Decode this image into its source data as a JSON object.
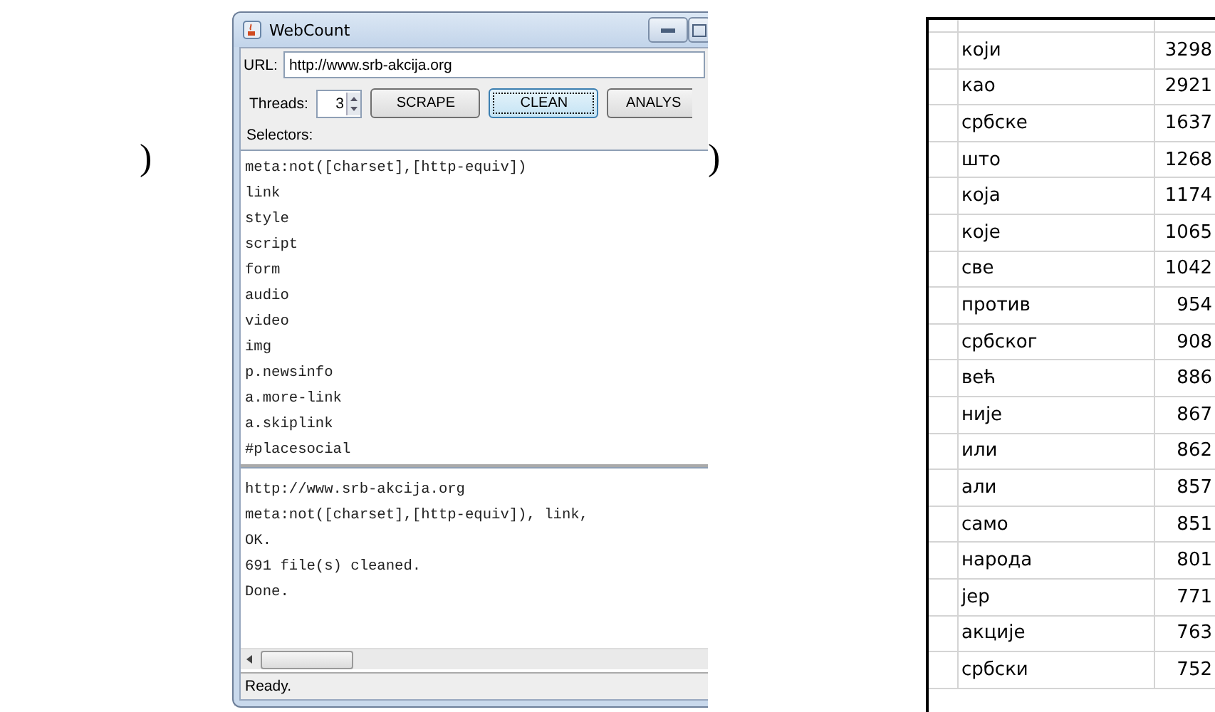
{
  "brackets": [
    ")",
    ")"
  ],
  "window": {
    "title": "WebCount",
    "url_label": "URL:",
    "url": "http://www.srb-akcija.org",
    "threads_label": "Threads:",
    "threads": "3",
    "buttons": [
      {
        "label": "SCRAPE",
        "focused": false
      },
      {
        "label": "CLEAN",
        "focused": true
      },
      {
        "label": "ANALYS",
        "focused": false
      }
    ],
    "selectors_label": "Selectors:",
    "selectors": [
      "meta:not([charset],[http-equiv])",
      "link",
      "style",
      "script",
      "form",
      "audio",
      "video",
      "img",
      "p.newsinfo",
      "a.more-link",
      "a.skiplink",
      "#placesocial"
    ],
    "log": [
      "http://www.srb-akcija.org",
      "meta:not([charset],[http-equiv]), link,",
      "OK.",
      "691 file(s) cleaned.",
      "Done."
    ],
    "status_bar": "Ready."
  },
  "table": {
    "rows": [
      {
        "word": "који",
        "count": "3298"
      },
      {
        "word": "као",
        "count": "2921"
      },
      {
        "word": "србске",
        "count": "1637"
      },
      {
        "word": "што",
        "count": "1268"
      },
      {
        "word": "која",
        "count": "1174"
      },
      {
        "word": "које",
        "count": "1065"
      },
      {
        "word": "све",
        "count": "1042"
      },
      {
        "word": "против",
        "count": "954"
      },
      {
        "word": "србског",
        "count": "908"
      },
      {
        "word": "већ",
        "count": "886"
      },
      {
        "word": "није",
        "count": "867"
      },
      {
        "word": "или",
        "count": "862"
      },
      {
        "word": "али",
        "count": "857"
      },
      {
        "word": "само",
        "count": "851"
      },
      {
        "word": "народа",
        "count": "801"
      },
      {
        "word": "јер",
        "count": "771"
      },
      {
        "word": "акције",
        "count": "763"
      },
      {
        "word": "србски",
        "count": "752"
      }
    ]
  }
}
